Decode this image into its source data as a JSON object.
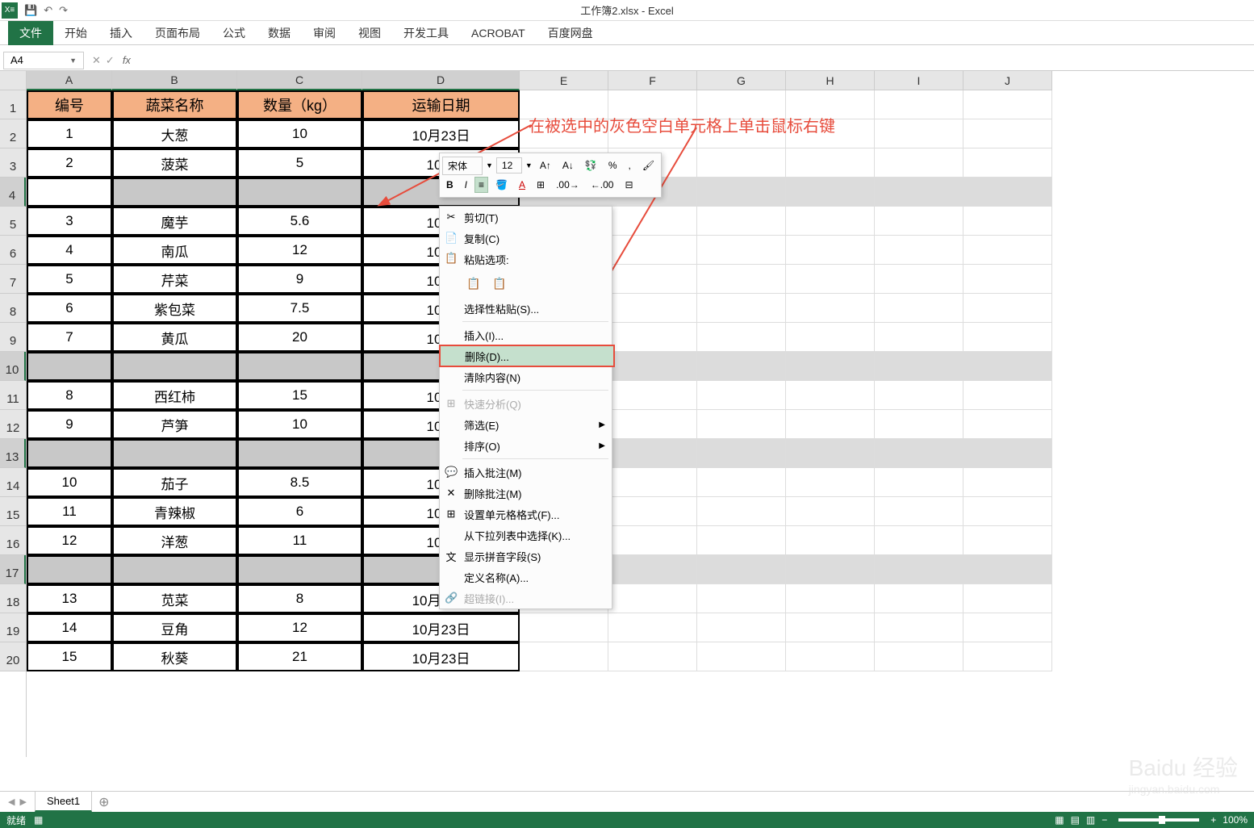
{
  "app": {
    "title": "工作簿2.xlsx - Excel",
    "icon": "X≡"
  },
  "qat": {
    "save": "💾",
    "undo": "↶",
    "redo": "↷"
  },
  "ribbon": {
    "file": "文件",
    "tabs": [
      "开始",
      "插入",
      "页面布局",
      "公式",
      "数据",
      "审阅",
      "视图",
      "开发工具",
      "ACROBAT",
      "百度网盘"
    ]
  },
  "formula": {
    "name_box": "A4",
    "fx": "fx"
  },
  "columns": [
    "A",
    "B",
    "C",
    "D",
    "E",
    "F",
    "G",
    "H",
    "I",
    "J"
  ],
  "col_widths": [
    "wA",
    "wB",
    "wC",
    "wD",
    "wE",
    "wF",
    "wG",
    "wH",
    "wI",
    "wJ"
  ],
  "table": {
    "headers": [
      "编号",
      "蔬菜名称",
      "数量（kg）",
      "运输日期"
    ],
    "rows": [
      {
        "n": "1",
        "name": "大葱",
        "qty": "10",
        "date": "10月23日",
        "sel": false
      },
      {
        "n": "2",
        "name": "菠菜",
        "qty": "5",
        "date": "10月",
        "sel": false
      },
      {
        "n": "",
        "name": "",
        "qty": "",
        "date": "",
        "sel": true,
        "active": true
      },
      {
        "n": "3",
        "name": "魔芋",
        "qty": "5.6",
        "date": "10月",
        "sel": false
      },
      {
        "n": "4",
        "name": "南瓜",
        "qty": "12",
        "date": "10月",
        "sel": false
      },
      {
        "n": "5",
        "name": "芹菜",
        "qty": "9",
        "date": "10月",
        "sel": false
      },
      {
        "n": "6",
        "name": "紫包菜",
        "qty": "7.5",
        "date": "10月",
        "sel": false
      },
      {
        "n": "7",
        "name": "黄瓜",
        "qty": "20",
        "date": "10月",
        "sel": false
      },
      {
        "n": "",
        "name": "",
        "qty": "",
        "date": "",
        "sel": true
      },
      {
        "n": "8",
        "name": "西红柿",
        "qty": "15",
        "date": "10月",
        "sel": false
      },
      {
        "n": "9",
        "name": "芦笋",
        "qty": "10",
        "date": "10月",
        "sel": false
      },
      {
        "n": "",
        "name": "",
        "qty": "",
        "date": "",
        "sel": true
      },
      {
        "n": "10",
        "name": "茄子",
        "qty": "8.5",
        "date": "10月",
        "sel": false
      },
      {
        "n": "11",
        "name": "青辣椒",
        "qty": "6",
        "date": "10月",
        "sel": false
      },
      {
        "n": "12",
        "name": "洋葱",
        "qty": "11",
        "date": "10月",
        "sel": false
      },
      {
        "n": "",
        "name": "",
        "qty": "",
        "date": "",
        "sel": true
      },
      {
        "n": "13",
        "name": "苋菜",
        "qty": "8",
        "date": "10月23日",
        "sel": false
      },
      {
        "n": "14",
        "name": "豆角",
        "qty": "12",
        "date": "10月23日",
        "sel": false
      },
      {
        "n": "15",
        "name": "秋葵",
        "qty": "21",
        "date": "10月23日",
        "sel": false
      }
    ]
  },
  "mini_toolbar": {
    "font": "宋体",
    "size": "12"
  },
  "context_menu": {
    "cut": "剪切(T)",
    "copy": "复制(C)",
    "paste_options": "粘贴选项:",
    "paste_special": "选择性粘贴(S)...",
    "insert": "插入(I)...",
    "delete": "删除(D)...",
    "clear": "清除内容(N)",
    "quick_analysis": "快速分析(Q)",
    "filter": "筛选(E)",
    "sort": "排序(O)",
    "insert_comment": "插入批注(M)",
    "delete_comment": "删除批注(M)",
    "format_cells": "设置单元格格式(F)...",
    "dropdown": "从下拉列表中选择(K)...",
    "phonetic": "显示拼音字段(S)",
    "define_name": "定义名称(A)...",
    "hyperlink": "超链接(I)..."
  },
  "callout": "在被选中的灰色空白单元格上单击鼠标右键",
  "sheet": {
    "name": "Sheet1"
  },
  "status": {
    "ready": "就绪",
    "zoom": "100%"
  },
  "watermark": {
    "main": "Baidu 经验",
    "sub": "jingyan.baidu.com"
  }
}
